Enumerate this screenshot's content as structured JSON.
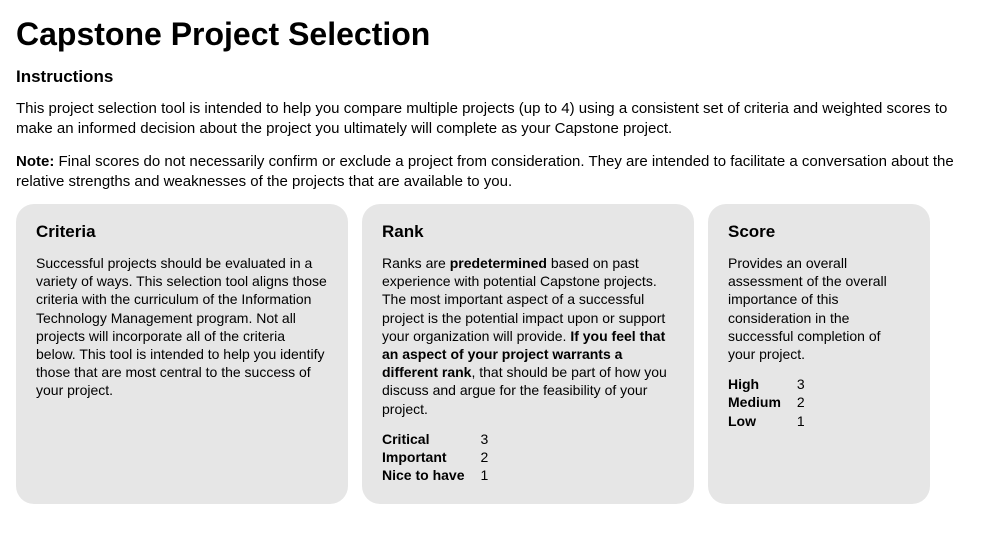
{
  "title": "Capstone Project Selection",
  "instructions_heading": "Instructions",
  "intro_para": "This project selection tool is intended to help you compare multiple projects (up to 4) using a consistent set of criteria and weighted scores to make an informed decision about the project you ultimately will complete as your Capstone project.",
  "note_label": "Note:",
  "note_text": "Final scores do not necessarily confirm or exclude a project from consideration. They are intended to facilitate a conversation about the relative strengths and weaknesses of the projects that are available to you.",
  "cards": {
    "criteria": {
      "title": "Criteria",
      "body": "Successful projects should be evaluated in a variety of ways. This selection tool aligns those criteria with the curriculum of the Information Technology Management program. Not all projects will incorporate all of the criteria below. This tool is intended to help you identify those that are most central to the success of your project."
    },
    "rank": {
      "title": "Rank",
      "body_pre": "Ranks are ",
      "body_bold1": "predetermined",
      "body_mid": " based on past experience with potential Capstone projects. The most important aspect of a successful project is the potential impact upon or support your organization will provide. ",
      "body_bold2": "If you feel that an aspect of your project warrants a different rank",
      "body_post": ", that should be part of how you discuss and argue for the feasibility of your project.",
      "levels": [
        {
          "label": "Critical",
          "value": "3"
        },
        {
          "label": "Important",
          "value": "2"
        },
        {
          "label": "Nice to have",
          "value": "1"
        }
      ]
    },
    "score": {
      "title": "Score",
      "body": "Provides an overall assessment of the overall importance of this consideration in the successful completion of your project.",
      "levels": [
        {
          "label": "High",
          "value": "3"
        },
        {
          "label": "Medium",
          "value": "2"
        },
        {
          "label": "Low",
          "value": "1"
        }
      ]
    }
  }
}
